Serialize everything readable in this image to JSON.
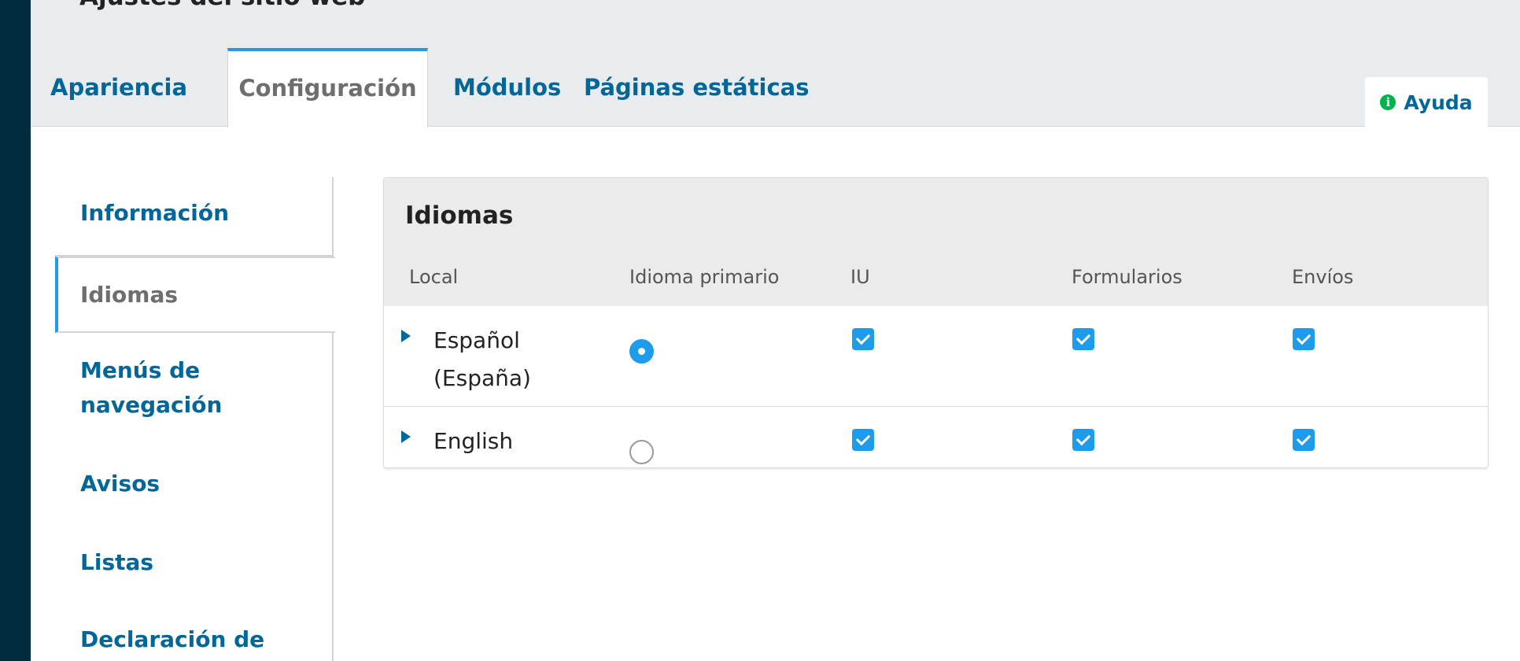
{
  "page": {
    "title": "Ajustes del sitio web"
  },
  "tabs": [
    {
      "label": "Apariencia",
      "active": false
    },
    {
      "label": "Configuración",
      "active": true
    },
    {
      "label": "Módulos",
      "active": false
    },
    {
      "label": "Páginas estáticas",
      "active": false
    }
  ],
  "help": {
    "label": "Ayuda",
    "icon": "info-circle-icon",
    "icon_color": "#00b24e"
  },
  "side_nav": {
    "items": [
      {
        "label": "Información",
        "active": false
      },
      {
        "label": "Idiomas",
        "active": true
      },
      {
        "label": "Menús de navegación",
        "active": false
      },
      {
        "label": "Avisos",
        "active": false
      },
      {
        "label": "Listas",
        "active": false
      },
      {
        "label": "Declaración de",
        "active": false
      }
    ]
  },
  "languages_panel": {
    "title": "Idiomas",
    "columns": [
      "Local",
      "Idioma primario",
      "IU",
      "Formularios",
      "Envíos"
    ],
    "rows": [
      {
        "locale": "Español (España)",
        "primary": true,
        "ui": true,
        "forms": true,
        "submissions": true
      },
      {
        "locale": "English",
        "primary": false,
        "ui": true,
        "forms": true,
        "submissions": true
      }
    ]
  },
  "colors": {
    "accent": "#1e9bea",
    "link": "#006798",
    "sidebar_dark": "#002c3e",
    "header_bg": "#e9ecee"
  }
}
